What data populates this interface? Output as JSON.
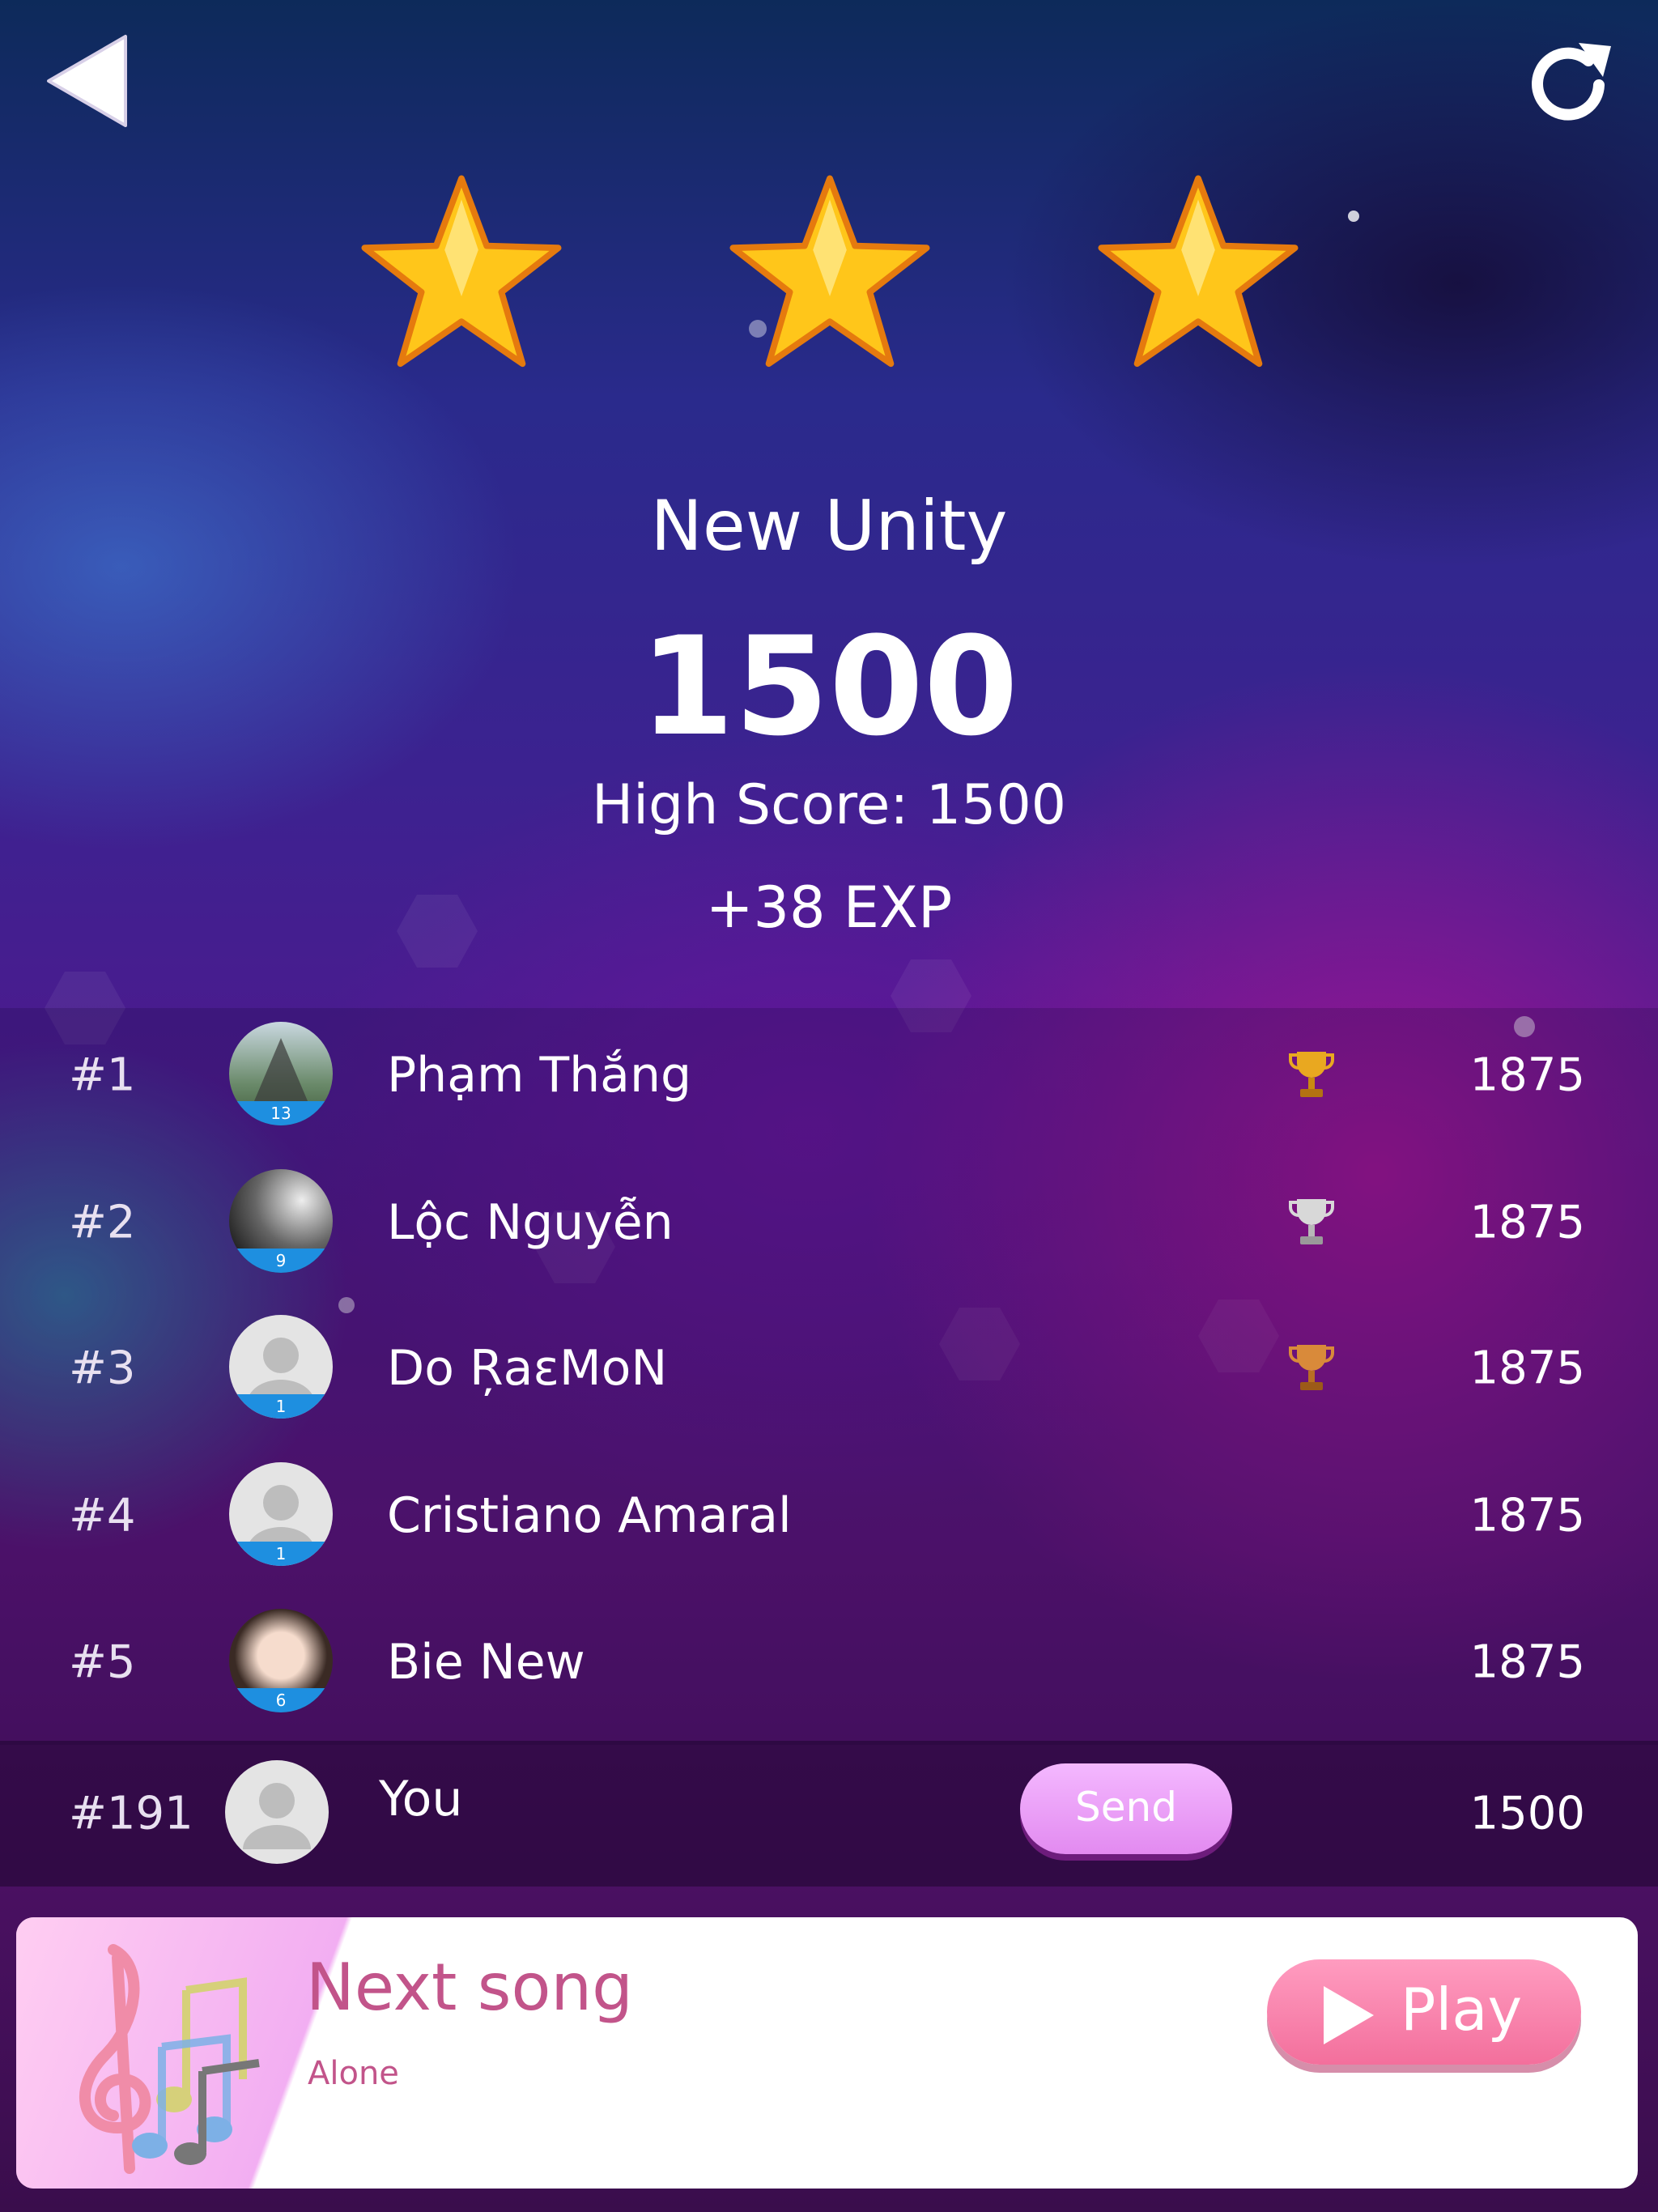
{
  "toolbar": {
    "back_icon": "back-triangle-icon",
    "reload_icon": "reload-icon"
  },
  "result": {
    "stars_earned": 3,
    "stars_total": 3,
    "song_title": "New Unity",
    "score": "1500",
    "high_score": "High Score: 1500",
    "exp": "+38 EXP"
  },
  "leaderboard": [
    {
      "rank": "#1",
      "name": "Phạm Thắng",
      "level": "13",
      "trophy": "gold",
      "score": "1875",
      "avatar": "photo-tent"
    },
    {
      "rank": "#2",
      "name": "Lộc Nguyễn",
      "level": "9",
      "trophy": "silver",
      "score": "1875",
      "avatar": "photo-bw"
    },
    {
      "rank": "#3",
      "name": "Do ŖaεMoN",
      "level": "1",
      "trophy": "bronze",
      "score": "1875",
      "avatar": "default"
    },
    {
      "rank": "#4",
      "name": "Cristiano  Amaral",
      "level": "1",
      "trophy": "",
      "score": "1875",
      "avatar": "default"
    },
    {
      "rank": "#5",
      "name": "Bie New",
      "level": "6",
      "trophy": "",
      "score": "1875",
      "avatar": "photo-face"
    }
  ],
  "you": {
    "rank": "#191",
    "name": "You",
    "send_label": "Send",
    "score": "1500"
  },
  "next_song": {
    "label": "Next song",
    "title": "Alone",
    "play_label": "Play"
  },
  "colors": {
    "accent_pink": "#f36f9c",
    "send_pink": "#e28af0",
    "level_blue": "#1e8fe0",
    "next_text": "#c2548a"
  }
}
